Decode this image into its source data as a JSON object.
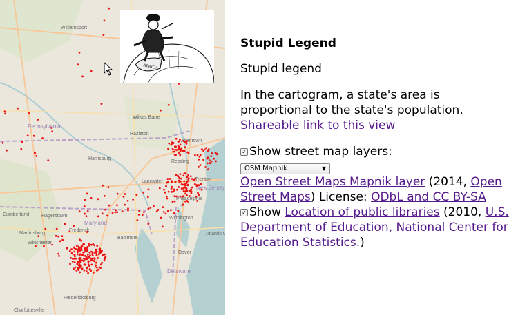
{
  "map": {
    "place_labels": [
      "Wilkes Barre",
      "Hazleton",
      "Harrisburg",
      "Lancaster",
      "Reading",
      "Allentown",
      "Trenton",
      "Hagerstown",
      "Martinsburg",
      "Winchester",
      "Frederick",
      "Baltimore",
      "Dover",
      "Atlantic City",
      "Fredericksburg",
      "Charlottesville",
      "Maryland",
      "Pennsylvania",
      "Delaware",
      "New Jersey",
      "Cumberland",
      "Williamsport",
      "Philadelphia",
      "Wilmington"
    ]
  },
  "legend_image": {
    "caption": "AFRICA",
    "alt": "Stupid legend cartoon"
  },
  "panel": {
    "title": "Stupid Legend",
    "subtitle": "Stupid legend",
    "description": "In the cartogram, a state's area is proportional to the state's population.",
    "share_link": "Shareable link to this view",
    "street_layers_label": "Show street map layers:",
    "street_layers_checked": true,
    "layer_select_value": "OSM Mapnik",
    "osm_layer_link": "Open Street Maps Mapnik layer",
    "osm_year": " (2014, ",
    "osm_link": "Open Street Maps",
    "osm_license_prefix": ") License: ",
    "osm_license_link": "ODbL and CC BY-SA",
    "libraries_checked": true,
    "libraries_prefix": "Show ",
    "libraries_link": "Location of public libraries",
    "libraries_year": " (2010, ",
    "dept_link": "U.S. Department of Education, National Center for Education Statistics.",
    "closing": ")"
  }
}
